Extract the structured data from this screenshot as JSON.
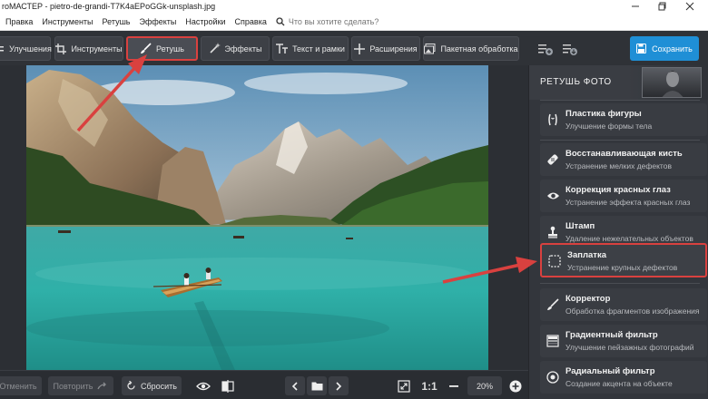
{
  "window": {
    "title": "roМАСТЕР - pietro-de-grandi-T7K4aEPoGGk-unsplash.jpg",
    "minimize_icon": "minimize-icon",
    "maximize_icon": "maximize-icon",
    "close_icon": "close-icon"
  },
  "menu": {
    "items": [
      "Правка",
      "Инструменты",
      "Ретушь",
      "Эффекты",
      "Настройки",
      "Справка"
    ],
    "search_placeholder": "Что вы хотите сделать?"
  },
  "toolbar": {
    "improvements": "Улучшения",
    "tools": "Инструменты",
    "retouch": "Ретушь",
    "effects": "Эффекты",
    "text_frames": "Текст и рамки",
    "extensions": "Расширения",
    "batch": "Пакетная обработка",
    "save": "Сохранить",
    "active_tab": "retouch"
  },
  "bottom": {
    "undo": "Отменить",
    "redo": "Повторить",
    "reset": "Сбросить",
    "ratio": "1:1",
    "zoom": "20%"
  },
  "panel": {
    "title": "РЕТУШЬ ФОТО",
    "tools": [
      {
        "name": "Пластика фигуры",
        "desc": "Улучшение формы тела",
        "icon": "body-shape-icon"
      },
      {
        "name": "Восстанавливающая кисть",
        "desc": "Устранение мелких дефектов",
        "icon": "healing-brush-icon"
      },
      {
        "name": "Коррекция красных глаз",
        "desc": "Устранение эффекта красных глаз",
        "icon": "eye-icon"
      },
      {
        "name": "Штамп",
        "desc": "Удаление нежелательных объектов",
        "icon": "stamp-icon"
      },
      {
        "name": "Заплатка",
        "desc": "Устранение крупных дефектов",
        "icon": "patch-icon"
      },
      {
        "name": "Корректор",
        "desc": "Обработка фрагментов изображения",
        "icon": "brush-icon"
      },
      {
        "name": "Градиентный фильтр",
        "desc": "Улучшение пейзажных фотографий",
        "icon": "gradient-icon"
      },
      {
        "name": "Радиальный фильтр",
        "desc": "Создание акцента на объекте",
        "icon": "radial-icon"
      }
    ],
    "highlighted": "Заплатка"
  },
  "colors": {
    "accent": "#1f8fd6",
    "highlight": "#d9413f",
    "toolbar_bg": "#2f3237",
    "panel_bg": "#33363c"
  }
}
